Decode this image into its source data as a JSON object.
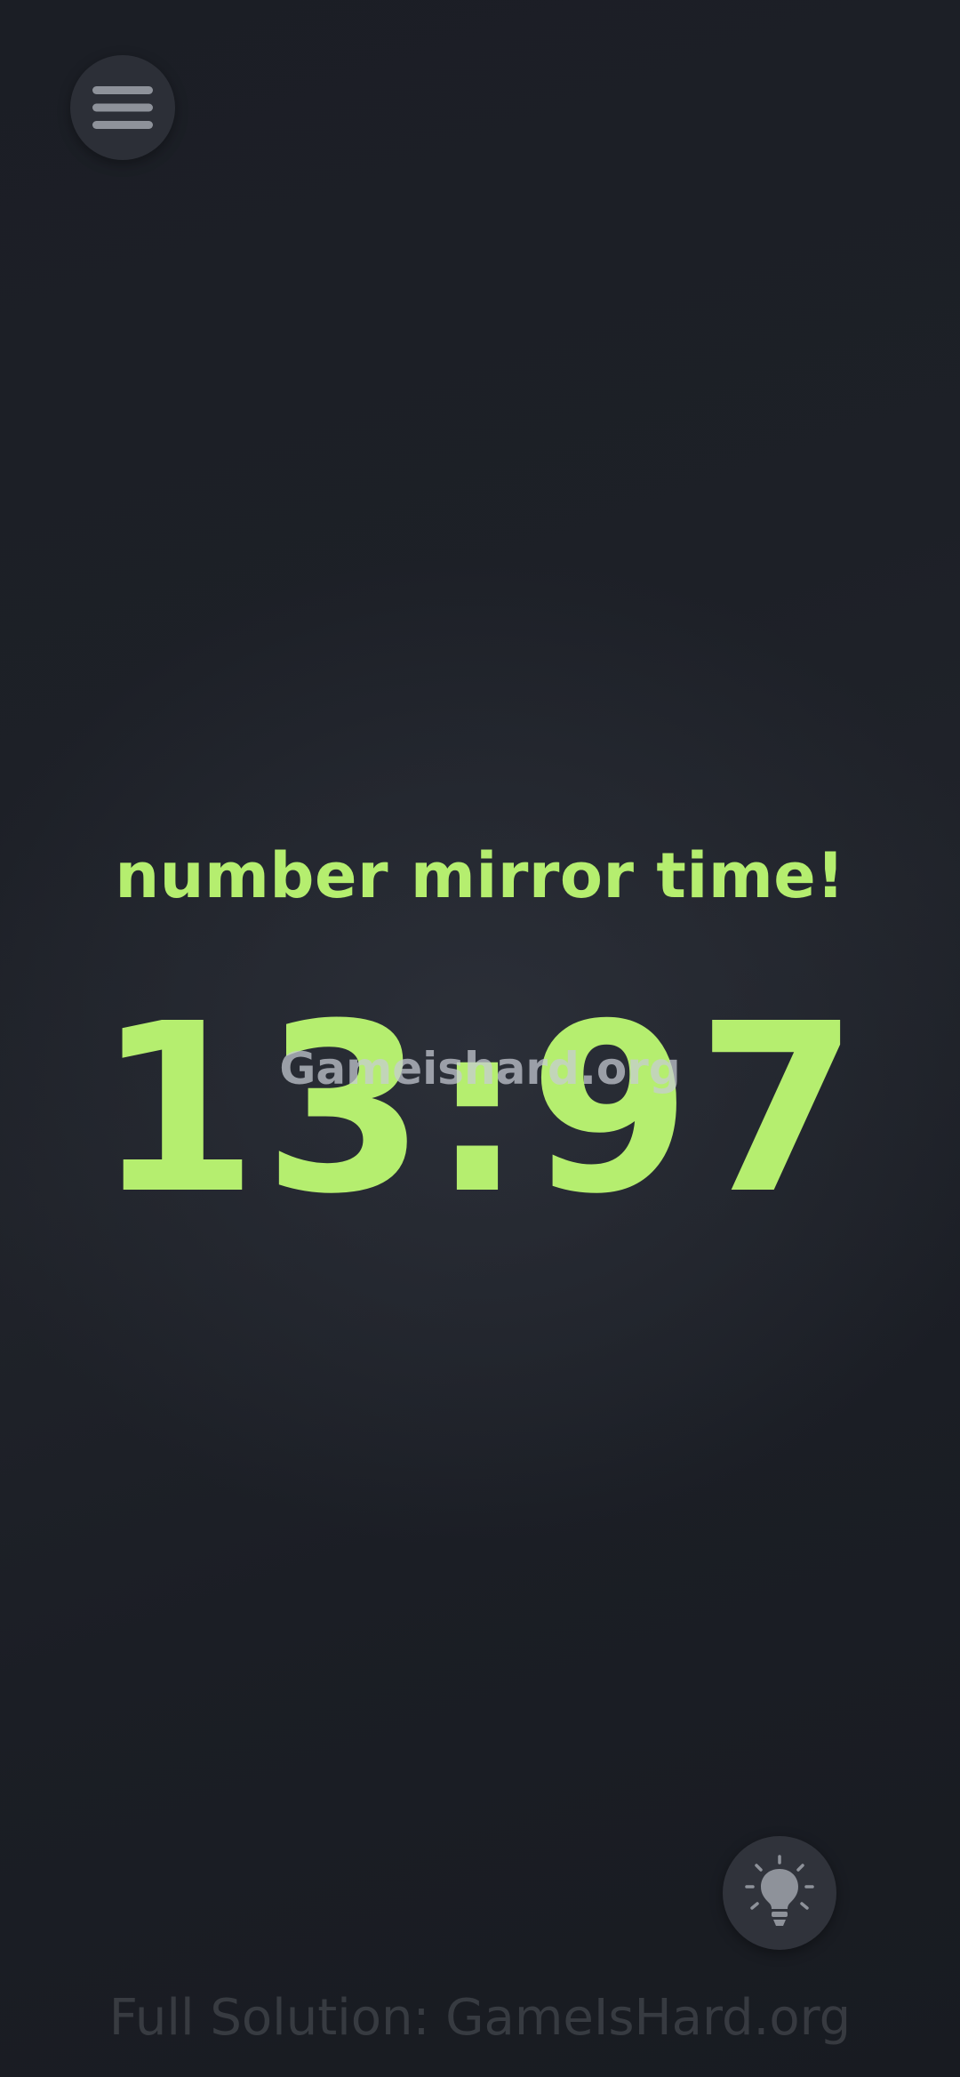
{
  "menu": {
    "icon": "hamburger-menu-icon"
  },
  "puzzle": {
    "headline": "number mirror time!",
    "clock": "13:97"
  },
  "hint": {
    "icon": "lightbulb-icon"
  },
  "watermark": {
    "overlay": "Gameishard.org",
    "footer": "Full Solution: GameIsHard.org"
  },
  "colors": {
    "accent": "#b5ee6f",
    "background": "#1a1d24",
    "button": "#2c2f37",
    "icon": "#8e929a"
  }
}
